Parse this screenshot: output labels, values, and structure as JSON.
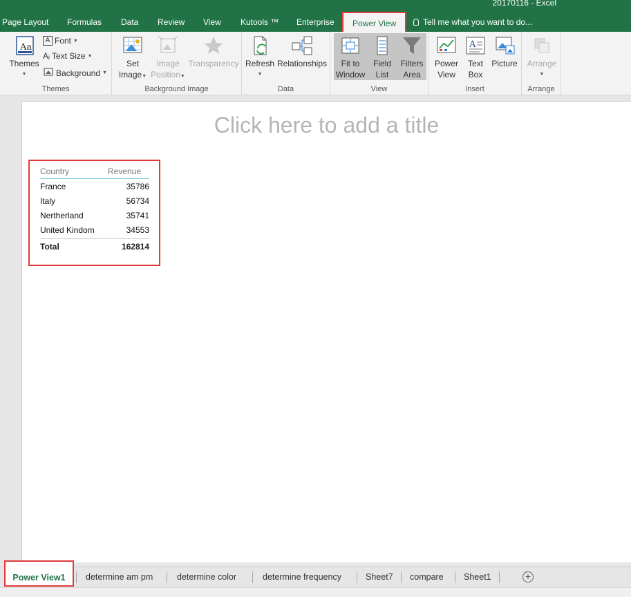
{
  "window": {
    "title": "20170116 - Excel"
  },
  "tabs": [
    {
      "label": "Page Layout"
    },
    {
      "label": "Formulas"
    },
    {
      "label": "Data"
    },
    {
      "label": "Review"
    },
    {
      "label": "View"
    },
    {
      "label": "Kutools ™"
    },
    {
      "label": "Enterprise"
    },
    {
      "label": "Power View"
    }
  ],
  "tell_me": "Tell me what you want to do...",
  "ribbon": {
    "themes": {
      "label": "Themes",
      "themes_btn": "Themes",
      "font": "Font",
      "text_size": "Text Size",
      "background": "Background"
    },
    "background_image": {
      "label": "Background Image",
      "set_image_1": "Set",
      "set_image_2": "Image",
      "image_position_1": "Image",
      "image_position_2": "Position",
      "transparency": "Transparency"
    },
    "data": {
      "label": "Data",
      "refresh": "Refresh",
      "relationships": "Relationships"
    },
    "view": {
      "label": "View",
      "fit_1": "Fit to",
      "fit_2": "Window",
      "field_1": "Field",
      "field_2": "List",
      "filters_1": "Filters",
      "filters_2": "Area"
    },
    "insert": {
      "label": "Insert",
      "pv_1": "Power",
      "pv_2": "View",
      "tb_1": "Text",
      "tb_2": "Box",
      "picture": "Picture"
    },
    "arrange": {
      "label": "Arrange",
      "arrange_btn": "Arrange"
    }
  },
  "report": {
    "title_placeholder": "Click here to add a title",
    "table": {
      "headers": [
        "Country",
        "Revenue"
      ],
      "rows": [
        {
          "country": "France",
          "revenue": "35786"
        },
        {
          "country": "Italy",
          "revenue": "56734"
        },
        {
          "country": "Nertherland",
          "revenue": "35741"
        },
        {
          "country": "United Kindom",
          "revenue": "34553"
        }
      ],
      "total_label": "Total",
      "total_value": "162814"
    }
  },
  "sheets": [
    {
      "label": "Power View1"
    },
    {
      "label": "determine am pm"
    },
    {
      "label": "determine color"
    },
    {
      "label": "determine frequency"
    },
    {
      "label": "Sheet7"
    },
    {
      "label": "compare"
    },
    {
      "label": "Sheet1"
    }
  ],
  "colors": {
    "excel_green": "#217346",
    "highlight_red": "#e03a3a"
  }
}
